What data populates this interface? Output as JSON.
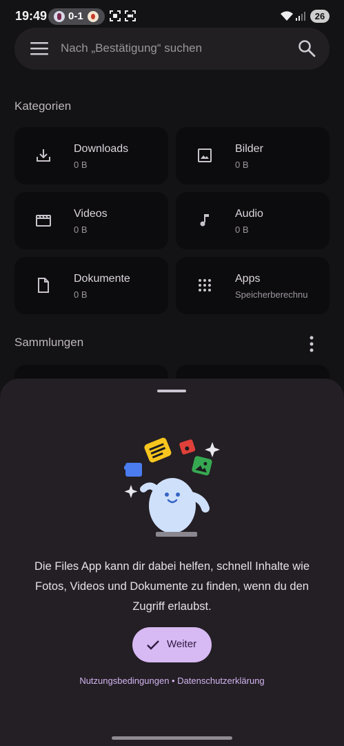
{
  "status_bar": {
    "time": "19:49",
    "score": "0-1",
    "battery": "26"
  },
  "search": {
    "placeholder": "Nach „Bestätigung“ suchen"
  },
  "categories": {
    "title": "Kategorien",
    "items": [
      {
        "label": "Downloads",
        "size": "0 B",
        "icon": "download-icon"
      },
      {
        "label": "Bilder",
        "size": "0 B",
        "icon": "image-icon"
      },
      {
        "label": "Videos",
        "size": "0 B",
        "icon": "movie-icon"
      },
      {
        "label": "Audio",
        "size": "0 B",
        "icon": "music-note-icon"
      },
      {
        "label": "Dokumente",
        "size": "0 B",
        "icon": "document-icon"
      },
      {
        "label": "Apps",
        "size": "r Speicherberechnu",
        "icon": "apps-grid-icon"
      }
    ]
  },
  "collections": {
    "title": "Sammlungen"
  },
  "sheet": {
    "message": "Die Files App kann dir dabei helfen, schnell Inhalte wie Fotos, Videos und Dokumente zu finden, wenn du den Zugriff erlaubst.",
    "continue_label": "Weiter",
    "terms_link": "Nutzungsbedingungen",
    "separator": " • ",
    "privacy_link": "Datenschutzerklärung"
  },
  "colors": {
    "background": "#131214",
    "card": "#0c0b0d",
    "sheet": "#231f24",
    "accent_button": "#d7b9f4",
    "link": "#d3b4f2"
  }
}
